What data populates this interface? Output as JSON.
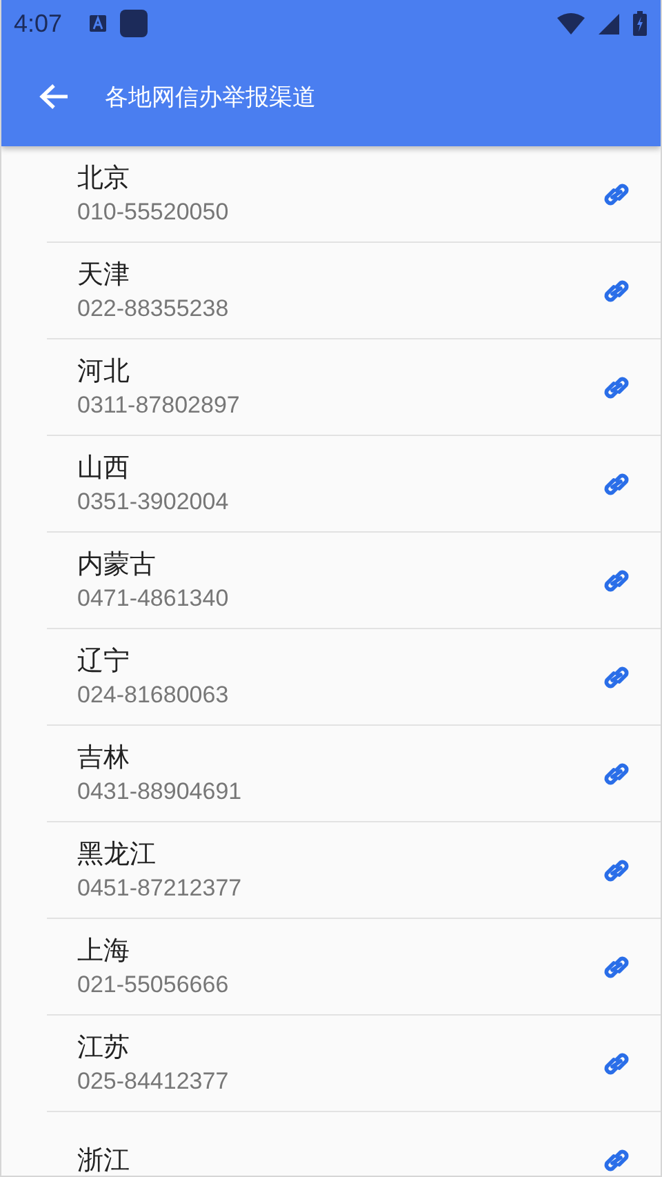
{
  "status_bar": {
    "time": "4:07"
  },
  "toolbar": {
    "title": "各地网信办举报渠道"
  },
  "channels": [
    {
      "name": "北京",
      "phone": "010-55520050"
    },
    {
      "name": "天津",
      "phone": "022-88355238"
    },
    {
      "name": "河北",
      "phone": "0311-87802897"
    },
    {
      "name": "山西",
      "phone": "0351-3902004"
    },
    {
      "name": "内蒙古",
      "phone": "0471-4861340"
    },
    {
      "name": "辽宁",
      "phone": "024-81680063"
    },
    {
      "name": "吉林",
      "phone": "0431-88904691"
    },
    {
      "name": "黑龙江",
      "phone": "0451-87212377"
    },
    {
      "name": "上海",
      "phone": "021-55056666"
    },
    {
      "name": "江苏",
      "phone": "025-84412377"
    },
    {
      "name": "浙江"
    }
  ]
}
